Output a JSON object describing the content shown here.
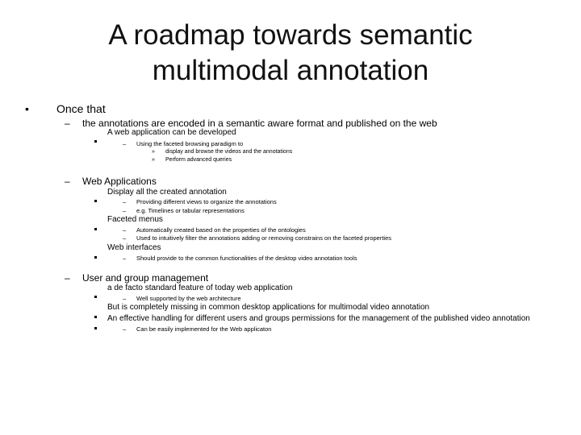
{
  "slide": {
    "title_line1": "A roadmap towards semantic",
    "title_line2": "multimodal annotation",
    "markers": {
      "level1": "•",
      "level2": "–",
      "level4": "–",
      "level5": "»"
    },
    "items": {
      "once_that": "Once that",
      "encoded": "the annotations are encoded in a semantic aware format and published on the web",
      "web_app_dev": "A web application can be developed",
      "faceted_paradigm": "Using the faceted browsing paradigm to",
      "display_browse": "display and browse the videos and the annotations",
      "perform_queries": "Perform advanced queries",
      "web_applications": "Web Applications",
      "display_all": "Display all the created annotation",
      "providing_views": "Providing different views to organize the annotations",
      "timelines": "e.g. Timelines or tabular representations",
      "faceted_menus": "Faceted menus",
      "auto_created": "Automatically created based on the properties of the ontologies",
      "used_filter": "Used to intuitively filter the annotations adding or removing constrains on the faceted properties",
      "web_interfaces": "Web interfaces",
      "should_provide": "Should provide to the common functionalities of the desktop video annotation tools",
      "user_group": "User and group management",
      "de_facto": "a de facto standard feature of today web application",
      "well_supported": "Well supported by the web architecture",
      "completely_missing": "But is completely missing in common desktop applications for multimodal video annotation",
      "effective_handling": "An effective handling for different users and groups permissions for the management of the published video annotation",
      "easily_implemented": "Can be easily implemented for the Web applicaton"
    }
  }
}
